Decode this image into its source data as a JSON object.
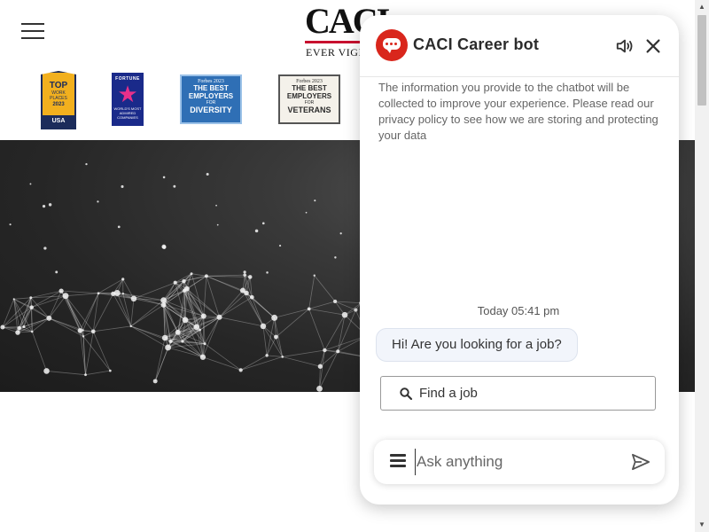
{
  "header": {
    "menu_icon": "hamburger-menu-icon",
    "logo": {
      "word": "CACI",
      "tagline": "EVER VIGILANT"
    }
  },
  "badges": {
    "top_workplaces": {
      "line1": "TOP",
      "line2": "WORK PLACES",
      "line3": "2023",
      "line4": "USA"
    },
    "fortune": {
      "line1": "FORTUNE",
      "line2": "WORLD'S MOST ADMIRED COMPANIES"
    },
    "forbes_diversity": {
      "brand": "Forbes 2023",
      "line1": "THE BEST",
      "line2": "EMPLOYERS",
      "line3": "FOR",
      "line4": "DIVERSITY"
    },
    "forbes_veterans": {
      "brand": "Forbes 2023",
      "line1": "THE BEST",
      "line2": "EMPLOYERS",
      "line3": "FOR",
      "line4": "VETERANS"
    }
  },
  "chat": {
    "title": "CACI Career bot",
    "avatar_icon": "chat-bubble-icon",
    "speaker_icon": "speaker-icon",
    "close_icon": "close-icon",
    "privacy_notice": "The information you provide to the chatbot will be collected to improve your experience. Please read our privacy policy to see how we are storing and protecting your data",
    "timestamp": "Today 05:41 pm",
    "bot_message": "Hi! Are you looking for a job?",
    "quick_reply": {
      "icon": "search-icon",
      "label": "Find a job"
    },
    "composer": {
      "menu_icon": "menu-icon",
      "placeholder": "Ask anything",
      "value": "",
      "send_icon": "send-icon"
    }
  },
  "colors": {
    "brand_red": "#d9261c",
    "logo_red": "#c8102e",
    "title_text": "#2b2b2b",
    "bubble_bg": "#f2f5fb"
  }
}
